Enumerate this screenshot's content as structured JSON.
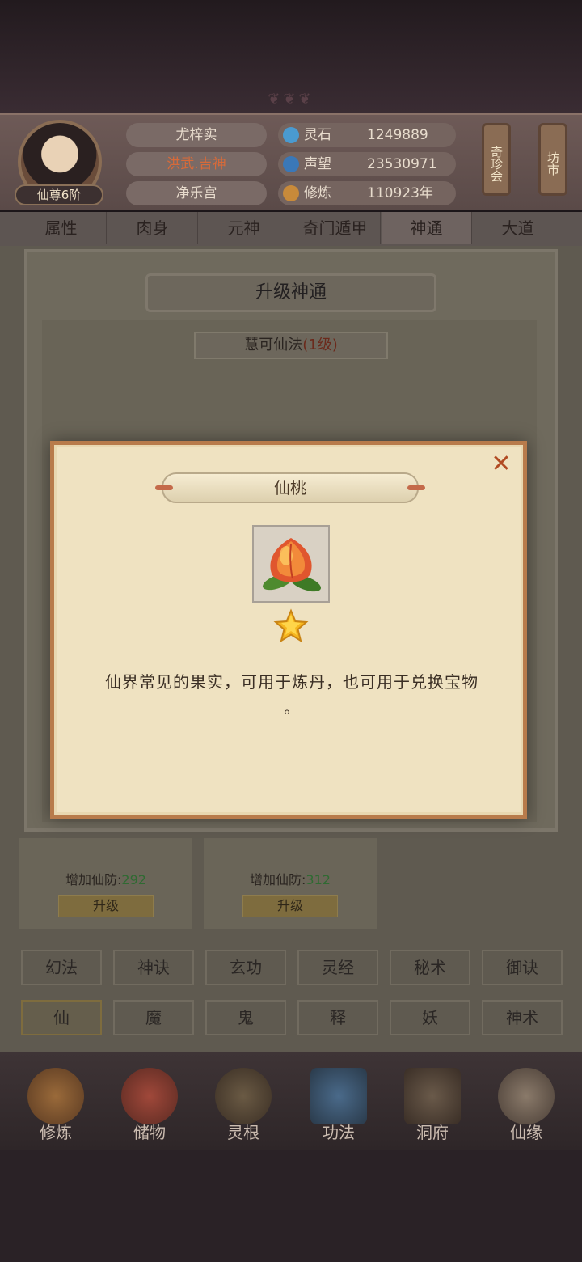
{
  "header": {
    "player_name": "尤梓实",
    "title": "洪武.吉神",
    "sect": "净乐宫",
    "rank": "仙尊6阶",
    "stats": [
      {
        "label": "灵石",
        "value": "1249889",
        "icon": "spirit-stone-icon",
        "color": "#4a9ad0"
      },
      {
        "label": "声望",
        "value": "23530971",
        "icon": "prestige-icon",
        "color": "#3a78b8"
      },
      {
        "label": "修炼",
        "value": "110923年",
        "icon": "cultivation-icon",
        "color": "#c88a3a"
      }
    ],
    "side_buttons": [
      "奇珍会",
      "坊市"
    ]
  },
  "tabs": [
    "属性",
    "肉身",
    "元神",
    "奇门遁甲",
    "神通",
    "大道"
  ],
  "active_tab": "神通",
  "upgrade_panel": {
    "title": "升级神通",
    "skill_name": "慧可仙法",
    "skill_level": "(1级)",
    "cards": [
      {
        "bonus_label": "增加仙防:",
        "bonus_value": "292",
        "button": "升级"
      },
      {
        "bonus_label": "增加仙防:",
        "bonus_value": "312",
        "button": "升级"
      }
    ]
  },
  "categories_row1": [
    "幻法",
    "神诀",
    "玄功",
    "灵经",
    "秘术",
    "御诀"
  ],
  "categories_row2": [
    "仙",
    "魔",
    "鬼",
    "释",
    "妖",
    "神术"
  ],
  "active_category": "仙",
  "bottom_nav": [
    {
      "label": "修炼",
      "icon": "cultivate-icon"
    },
    {
      "label": "储物",
      "icon": "storage-bag-icon"
    },
    {
      "label": "灵根",
      "icon": "spirit-root-icon"
    },
    {
      "label": "功法",
      "icon": "technique-book-icon"
    },
    {
      "label": "洞府",
      "icon": "cave-mansion-icon"
    },
    {
      "label": "仙缘",
      "icon": "immortal-fate-icon"
    }
  ],
  "dialog": {
    "title": "仙桃",
    "item_icon": "immortal-peach-icon",
    "rarity_stars": 1,
    "description_line1": "仙界常见的果实，可用于炼丹，也可用于兑换宝物",
    "description_line2": "。",
    "close_icon": "close-icon",
    "accent_color": "#b87b4b"
  }
}
